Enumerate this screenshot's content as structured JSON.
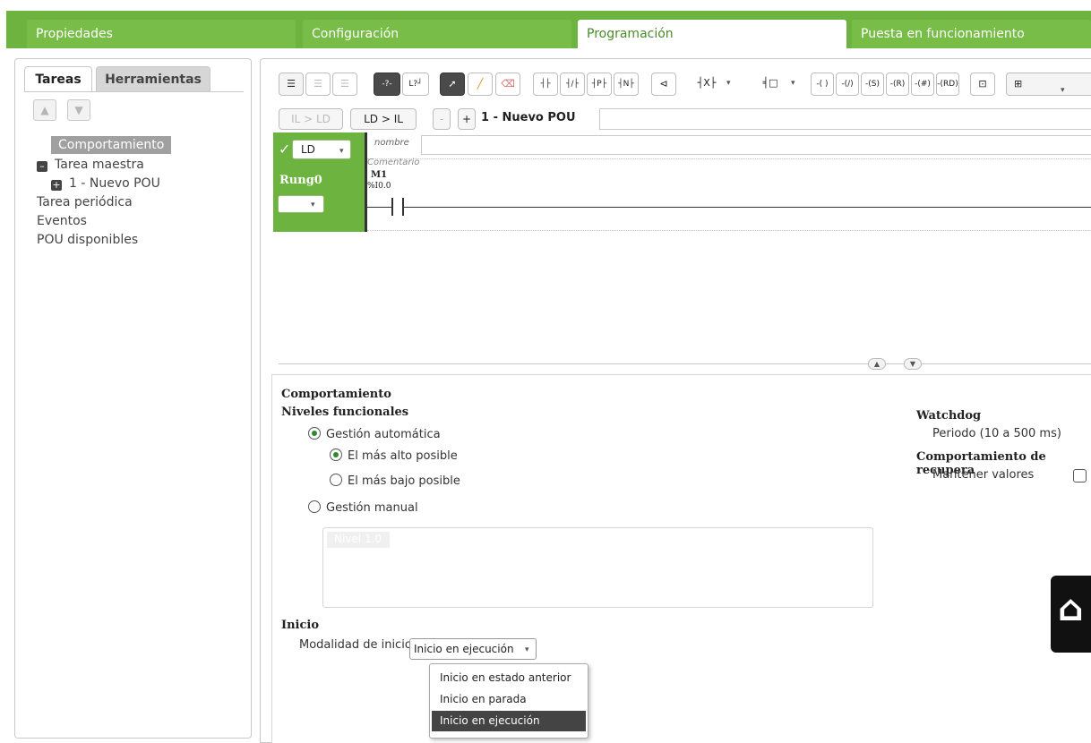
{
  "top_tabs": [
    {
      "label": "Propiedades"
    },
    {
      "label": "Configuración"
    },
    {
      "label": "Programación"
    },
    {
      "label": "Puesta en funcionamiento"
    }
  ],
  "left_panel": {
    "tabs": [
      {
        "label": "Tareas"
      },
      {
        "label": "Herramientas"
      }
    ],
    "tree": [
      {
        "label": "Comportamiento"
      },
      {
        "label": "Tarea maestra"
      },
      {
        "label": "1 - Nuevo POU"
      },
      {
        "label": "Tarea periódica"
      },
      {
        "label": "Eventos"
      },
      {
        "label": "POU disponibles"
      }
    ]
  },
  "toolbar": {
    "row2": {
      "il_to_ld": "IL > LD",
      "ld_to_il": "LD > IL",
      "minus": "-",
      "plus": "+",
      "pou_title": "1 - Nuevo POU"
    }
  },
  "rung": {
    "language": "LD",
    "name": "Rung0",
    "nombre_label": "nombre",
    "comment_label": "Comentario",
    "contact_symbol": "M1",
    "contact_address": "%I0.0"
  },
  "properties": {
    "title": "Comportamiento",
    "functional_levels": {
      "heading": "Niveles funcionales",
      "auto": "Gestión automática",
      "highest": "El más alto posible",
      "lowest": "El más bajo posible",
      "manual": "Gestión manual",
      "level_tag": "Nivel 1.0"
    },
    "watchdog": {
      "heading": "Watchdog",
      "period": "Periodo (10 a 500 ms)"
    },
    "recovery": {
      "heading": "Comportamiento de recupera",
      "keep_values": "Mantener valores"
    },
    "start": {
      "heading": "Inicio",
      "mode_label": "Modalidad de inicio",
      "selected": "Inicio en ejecución",
      "options": [
        {
          "label": "Inicio en estado anterior"
        },
        {
          "label": "Inicio en parada"
        },
        {
          "label": "Inicio en ejecución"
        }
      ]
    }
  },
  "colors": {
    "accent": "#6db33f",
    "selected_dark": "#444444"
  }
}
